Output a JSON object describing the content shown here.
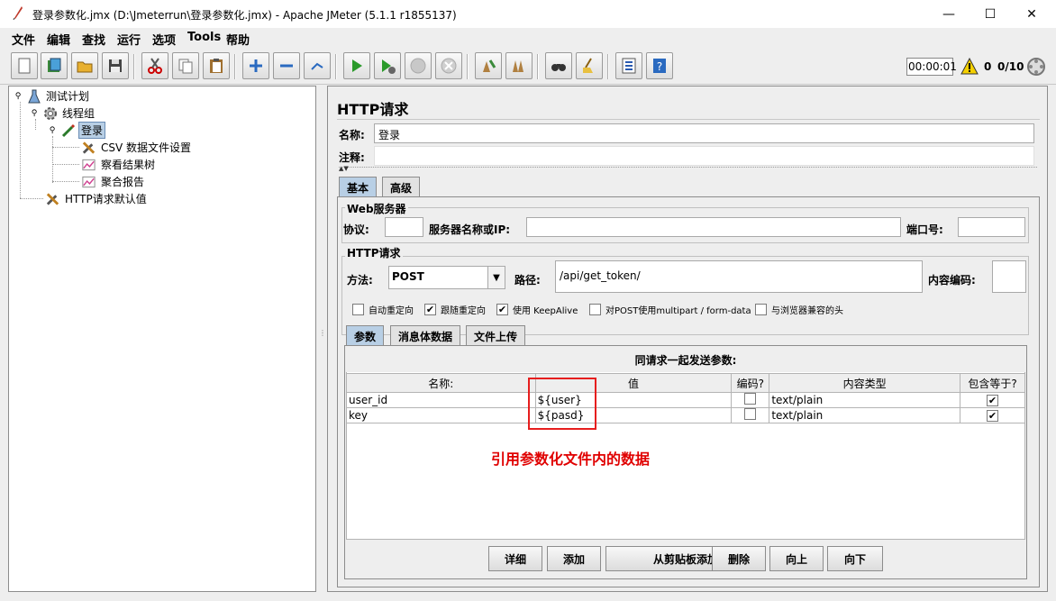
{
  "window": {
    "title": "登录参数化.jmx (D:\\Jmeterrun\\登录参数化.jmx) - Apache JMeter (5.1.1 r1855137)",
    "minimize": "—",
    "maximize": "☐",
    "close": "✕"
  },
  "menu": [
    "文件",
    "编辑",
    "查找",
    "运行",
    "选项",
    "Tools",
    "帮助"
  ],
  "toolbar": {
    "icons": [
      "new-icon",
      "templates-icon",
      "open-icon",
      "save-icon",
      "cut-icon",
      "copy-icon",
      "paste-icon",
      "expand-icon",
      "collapse-icon",
      "toggle-icon",
      "start-icon",
      "start-no-pause-icon",
      "stop-icon",
      "shutdown-icon",
      "clear-icon",
      "clear-all-icon",
      "search-icon",
      "reset-search-icon",
      "function-helper-icon",
      "help-icon"
    ],
    "timer": "00:00:01",
    "warnings": "0",
    "threads": "0/10"
  },
  "tree": {
    "nodes": [
      {
        "label": "测试计划",
        "icon": "test-plan-icon"
      },
      {
        "label": "线程组",
        "icon": "thread-group-icon"
      },
      {
        "label": "登录",
        "icon": "sampler-icon"
      },
      {
        "label": "CSV 数据文件设置",
        "icon": "config-icon"
      },
      {
        "label": "察看结果树",
        "icon": "listener-icon"
      },
      {
        "label": "聚合报告",
        "icon": "listener-icon"
      },
      {
        "label": "HTTP请求默认值",
        "icon": "config-icon"
      }
    ]
  },
  "panel": {
    "title": "HTTP请求",
    "name_label": "名称:",
    "name_value": "登录",
    "comment_label": "注释:",
    "comment_value": "",
    "tabs": [
      "基本",
      "高级"
    ],
    "web_server": {
      "title": "Web服务器",
      "protocol_label": "协议:",
      "protocol_value": "",
      "server_label": "服务器名称或IP:",
      "server_value": "",
      "port_label": "端口号:",
      "port_value": ""
    },
    "http_request": {
      "title": "HTTP请求",
      "method_label": "方法:",
      "method_value": "POST",
      "path_label": "路径:",
      "path_value": "/api/get_token/",
      "encoding_label": "内容编码:",
      "encoding_value": ""
    },
    "options": [
      {
        "label": "自动重定向",
        "checked": false
      },
      {
        "label": "跟随重定向",
        "checked": true
      },
      {
        "label": "使用 KeepAlive",
        "checked": true
      },
      {
        "label": "对POST使用multipart / form-data",
        "checked": false
      },
      {
        "label": "与浏览器兼容的头",
        "checked": false
      }
    ],
    "sub_tabs": [
      "参数",
      "消息体数据",
      "文件上传"
    ],
    "params": {
      "caption": "同请求一起发送参数:",
      "headers": [
        "名称:",
        "值",
        "编码?",
        "内容类型",
        "包含等于?"
      ],
      "rows": [
        {
          "name": "user_id",
          "value": "${user}",
          "encode": false,
          "content_type": "text/plain",
          "include_equals": true
        },
        {
          "name": "key",
          "value": "${pasd}",
          "encode": false,
          "content_type": "text/plain",
          "include_equals": true
        }
      ]
    },
    "annotation": "引用参数化文件内的数据",
    "buttons": [
      "详细",
      "添加",
      "从剪贴板添加",
      "删除",
      "向上",
      "向下"
    ]
  },
  "colors": {
    "annotation": "#e00000",
    "selection": "#b8cfe5"
  }
}
